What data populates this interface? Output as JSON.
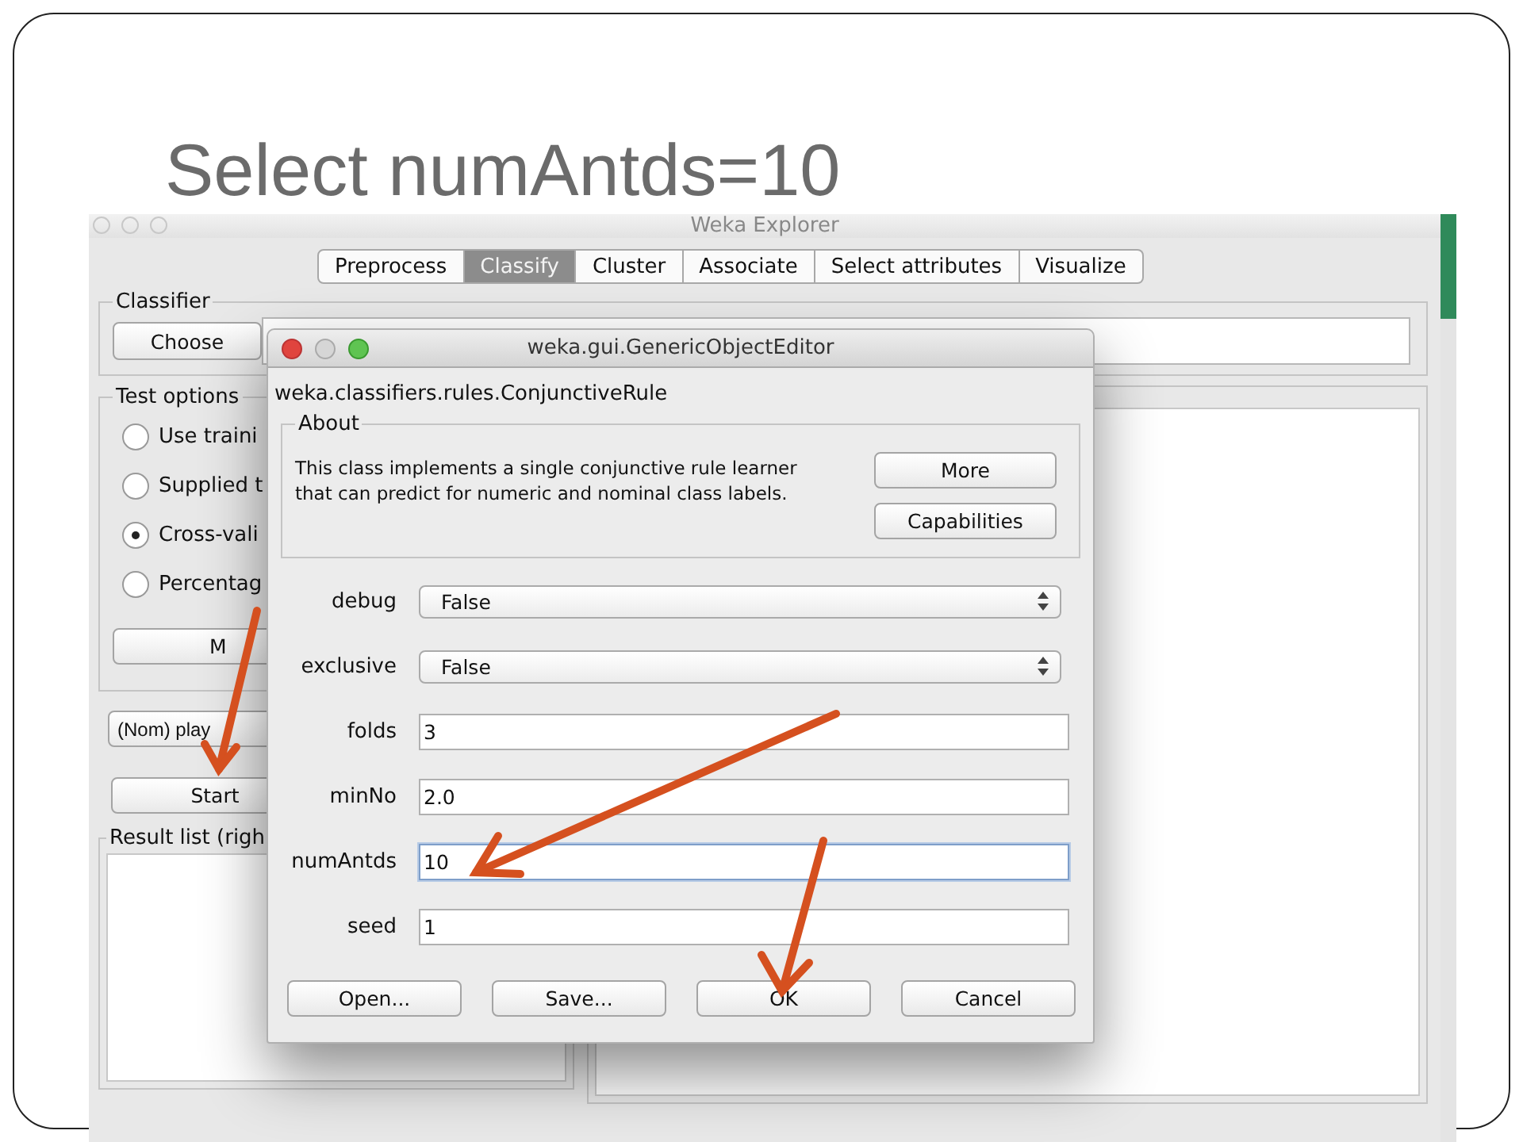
{
  "slide": {
    "title": "Select numAntds=10"
  },
  "explorer": {
    "title": "Weka Explorer",
    "tabs": [
      {
        "label": "Preprocess",
        "selected": false
      },
      {
        "label": "Classify",
        "selected": true
      },
      {
        "label": "Cluster",
        "selected": false
      },
      {
        "label": "Associate",
        "selected": false
      },
      {
        "label": "Select attributes",
        "selected": false
      },
      {
        "label": "Visualize",
        "selected": false
      }
    ],
    "classifier": {
      "label": "Classifier",
      "choose_button": "Choose"
    },
    "test_options": {
      "label": "Test options",
      "options": [
        {
          "label": "Use traini",
          "selected": false
        },
        {
          "label": "Supplied t",
          "selected": false
        },
        {
          "label": "Cross-vali",
          "selected": true
        },
        {
          "label": "Percentag",
          "selected": false
        }
      ],
      "more_button": "M"
    },
    "class_dropdown": "(Nom) play",
    "start_button": "Start",
    "result_list": {
      "label": "Result list (righ"
    }
  },
  "dialog": {
    "title": "weka.gui.GenericObjectEditor",
    "class_name": "weka.classifiers.rules.ConjunctiveRule",
    "about": {
      "label": "About",
      "text": "This class implements a single conjunctive rule learner\nthat can predict for numeric and nominal class labels.",
      "buttons": [
        "More",
        "Capabilities"
      ]
    },
    "properties": [
      {
        "name": "debug",
        "kind": "dropdown",
        "value": "False",
        "focused": false
      },
      {
        "name": "exclusive",
        "kind": "dropdown",
        "value": "False",
        "focused": false
      },
      {
        "name": "folds",
        "kind": "text",
        "value": "3",
        "focused": false
      },
      {
        "name": "minNo",
        "kind": "text",
        "value": "2.0",
        "focused": false
      },
      {
        "name": "numAntds",
        "kind": "text",
        "value": "10",
        "focused": true
      },
      {
        "name": "seed",
        "kind": "text",
        "value": "1",
        "focused": false
      }
    ],
    "buttons": [
      "Open...",
      "Save...",
      "OK",
      "Cancel"
    ]
  }
}
